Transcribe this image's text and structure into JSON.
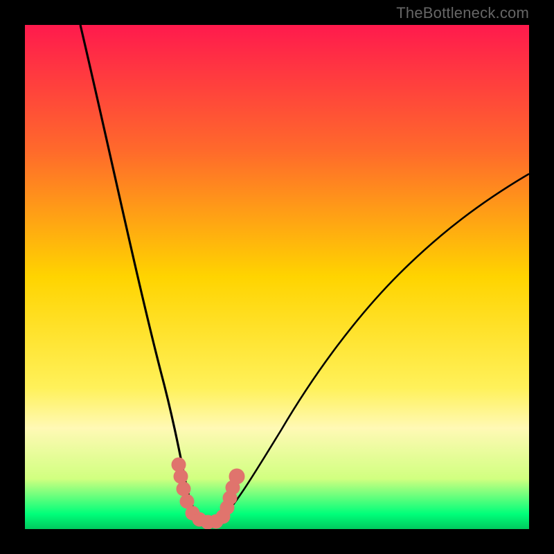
{
  "watermark": "TheBottleneck.com",
  "chart_data": {
    "type": "line",
    "title": "",
    "xlabel": "",
    "ylabel": "",
    "xlim": [
      0,
      100
    ],
    "ylim": [
      0,
      100
    ],
    "background_gradient": {
      "type": "vertical",
      "stops": [
        {
          "pos": 0.0,
          "color": "#ff1a4d"
        },
        {
          "pos": 0.25,
          "color": "#ff6a2b"
        },
        {
          "pos": 0.5,
          "color": "#ffd400"
        },
        {
          "pos": 0.72,
          "color": "#fff15a"
        },
        {
          "pos": 0.8,
          "color": "#fff9b5"
        },
        {
          "pos": 0.9,
          "color": "#d1ff80"
        },
        {
          "pos": 0.97,
          "color": "#00ff7a"
        },
        {
          "pos": 1.0,
          "color": "#00c95e"
        }
      ]
    },
    "series": [
      {
        "name": "bottleneck-curve",
        "note": "Approximate y (0=bottom,100=top) vs x (0=left,100=right) read from the plotted black curve. Estimated from gridless chart.",
        "x": [
          11,
          15,
          20,
          24,
          27,
          30,
          32,
          34,
          36,
          38,
          40,
          45,
          50,
          55,
          60,
          65,
          70,
          75,
          80,
          85,
          90,
          95,
          100
        ],
        "y": [
          100,
          80,
          58,
          40,
          24,
          12,
          6,
          3,
          2,
          2,
          3,
          8,
          15,
          22,
          30,
          37,
          44,
          50,
          55,
          60,
          64,
          68,
          71
        ]
      }
    ],
    "markers": {
      "note": "Salmon blob markers near curve minimum (approximate x,y).",
      "points": [
        {
          "x": 30,
          "y": 12
        },
        {
          "x": 30.5,
          "y": 9
        },
        {
          "x": 31,
          "y": 6
        },
        {
          "x": 33,
          "y": 3
        },
        {
          "x": 35,
          "y": 2.5
        },
        {
          "x": 37,
          "y": 2.5
        },
        {
          "x": 38.5,
          "y": 3.5
        },
        {
          "x": 39,
          "y": 5
        },
        {
          "x": 39.5,
          "y": 7
        },
        {
          "x": 40.5,
          "y": 10
        }
      ]
    },
    "colors": {
      "curve": "#000000",
      "markers": "#e0746d",
      "frame": "#000000"
    }
  }
}
